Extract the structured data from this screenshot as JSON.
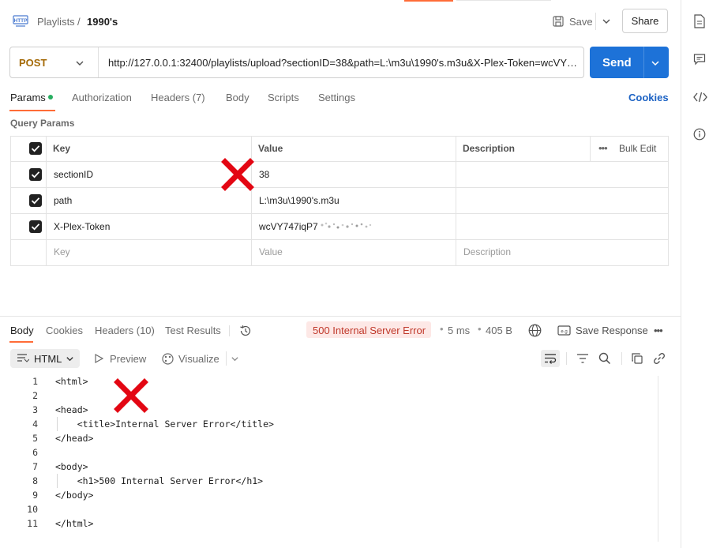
{
  "header": {
    "breadcrumb_parent": "Playlists",
    "breadcrumb_sep": "/",
    "breadcrumb_current": "1990's",
    "save_label": "Save",
    "share_label": "Share"
  },
  "request": {
    "method": "POST",
    "url": "http://127.0.0.1:32400/playlists/upload?sectionID=38&path=L:\\m3u\\1990's.m3u&X-Plex-Token=wcVY747iqP7...",
    "send_label": "Send"
  },
  "tabs": {
    "params": "Params",
    "authorization": "Authorization",
    "headers": "Headers (7)",
    "body": "Body",
    "scripts": "Scripts",
    "settings": "Settings",
    "cookies": "Cookies"
  },
  "query_params": {
    "title": "Query Params",
    "columns": {
      "key": "Key",
      "value": "Value",
      "description": "Description",
      "bulk_edit": "Bulk Edit"
    },
    "rows": [
      {
        "key": "sectionID",
        "value": "38",
        "description": ""
      },
      {
        "key": "path",
        "value": "L:\\m3u\\1990's.m3u",
        "description": ""
      },
      {
        "key": "X-Plex-Token",
        "value": "wcVY747iqP7",
        "description": ""
      }
    ],
    "placeholders": {
      "key": "Key",
      "value": "Value",
      "description": "Description"
    }
  },
  "response": {
    "tabs": {
      "body": "Body",
      "cookies": "Cookies",
      "headers": "Headers (10)",
      "test_results": "Test Results"
    },
    "status": "500 Internal Server Error",
    "time": "5 ms",
    "size": "405 B",
    "save_response": "Save Response",
    "format": "HTML",
    "preview": "Preview",
    "visualize": "Visualize",
    "code_lines": [
      {
        "n": "1",
        "text": "<html>"
      },
      {
        "n": "2",
        "text": ""
      },
      {
        "n": "3",
        "text": "<head>"
      },
      {
        "n": "4",
        "text": "    <title>Internal Server Error</title>"
      },
      {
        "n": "5",
        "text": "</head>"
      },
      {
        "n": "6",
        "text": ""
      },
      {
        "n": "7",
        "text": "<body>"
      },
      {
        "n": "8",
        "text": "    <h1>500 Internal Server Error</h1>"
      },
      {
        "n": "9",
        "text": "</body>"
      },
      {
        "n": "10",
        "text": ""
      },
      {
        "n": "11",
        "text": "</html>"
      }
    ]
  },
  "colors": {
    "accent": "#ff6c37",
    "send": "#1d72d8",
    "method": "#a46a07",
    "error": "#c0392b",
    "annotation_red": "#e30613"
  }
}
